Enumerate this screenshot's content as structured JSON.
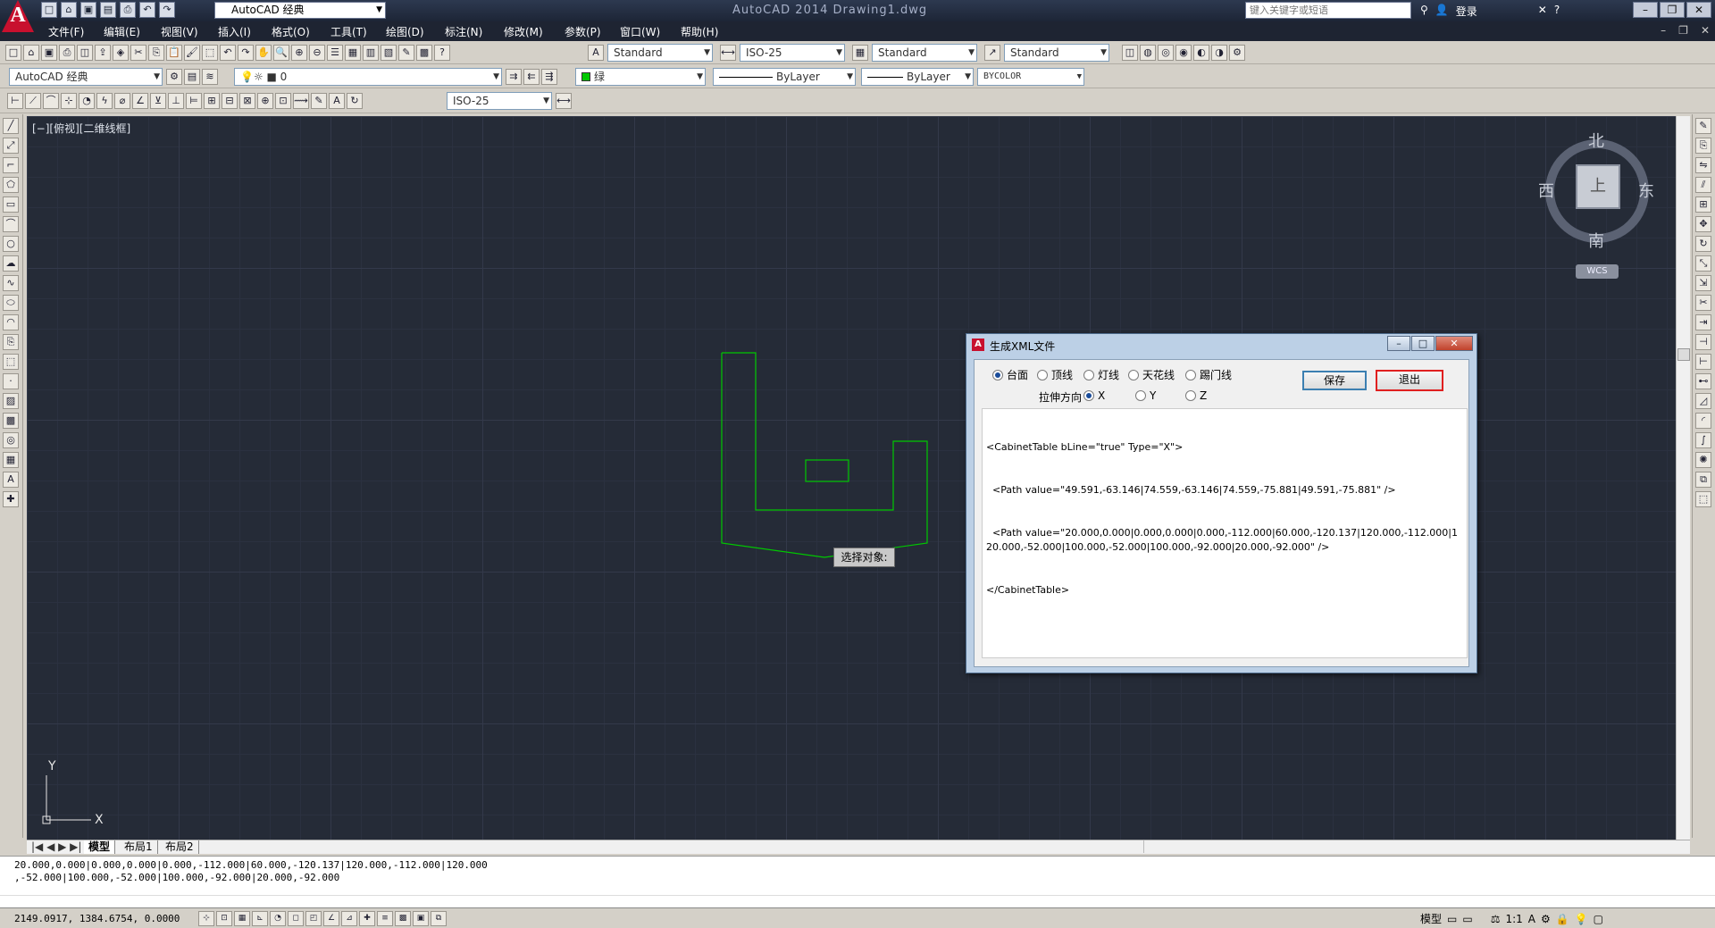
{
  "app": {
    "logo_letter": "A",
    "workspace": "AutoCAD 经典",
    "title": "AutoCAD 2014    Drawing1.dwg",
    "search_placeholder": "键入关键字或短语",
    "login_label": "登录"
  },
  "quick_access": [
    "new-icon",
    "open-icon",
    "save-icon",
    "saveas-icon",
    "print-icon",
    "undo-icon",
    "redo-icon"
  ],
  "menu": {
    "items": [
      "文件(F)",
      "编辑(E)",
      "视图(V)",
      "插入(I)",
      "格式(O)",
      "工具(T)",
      "绘图(D)",
      "标注(N)",
      "修改(M)",
      "参数(P)",
      "窗口(W)",
      "帮助(H)"
    ]
  },
  "toolbar1": {
    "text_style": "Standard",
    "dim_style": "ISO-25",
    "table_style": "Standard",
    "mleader_style": "Standard"
  },
  "toolbar2": {
    "workspace": "AutoCAD 经典",
    "layer": "0",
    "color": "绿",
    "linetype": "ByLayer",
    "lineweight": "ByLayer",
    "plotstyle": "BYCOLOR"
  },
  "toolbar3": {
    "dim_style": "ISO-25"
  },
  "viewport": {
    "label": "[−][俯视][二维线框]"
  },
  "viewcube": {
    "north": "北",
    "south": "南",
    "east": "东",
    "west": "西",
    "face": "上",
    "wcs": "WCS"
  },
  "ucs": {
    "x": "X",
    "y": "Y"
  },
  "tooltip": {
    "text": "选择对象:"
  },
  "layout_tabs": [
    "模型",
    "布局1",
    "布局2"
  ],
  "dialog": {
    "title": "生成XML文件",
    "options": [
      {
        "label": "台面",
        "checked": true
      },
      {
        "label": "顶线",
        "checked": false
      },
      {
        "label": "灯线",
        "checked": false
      },
      {
        "label": "天花线",
        "checked": false
      },
      {
        "label": "踢门线",
        "checked": false
      }
    ],
    "direction_label": "拉伸方向",
    "directions": [
      {
        "label": "X",
        "checked": true
      },
      {
        "label": "Y",
        "checked": false
      },
      {
        "label": "Z",
        "checked": false
      }
    ],
    "save_label": "保存",
    "exit_label": "退出",
    "xml_lines": [
      "<CabinetTable bLine=\"true\" Type=\"X\">",
      "  <Path value=\"49.591,-63.146|74.559,-63.146|74.559,-75.881|49.591,-75.881\" />",
      "  <Path value=\"20.000,0.000|0.000,0.000|0.000,-112.000|60.000,-120.137|120.000,-112.000|120.000,-52.000|100.000,-52.000|100.000,-92.000|20.000,-92.000\" />",
      "</CabinetTable>"
    ]
  },
  "command_line": {
    "line1": "20.000,0.000|0.000,0.000|0.000,-112.000|60.000,-120.137|120.000,-112.000|120.000",
    "line2": ",-52.000|100.000,-52.000|100.000,-92.000|20.000,-92.000"
  },
  "status": {
    "coords": "2149.0917,  1384.6754,  0.0000",
    "model_label": "模型",
    "scale": "1:1"
  },
  "colors": {
    "drawing_bg": "#252b37",
    "geometry": "#00c800",
    "exit_highlight": "#e02020"
  }
}
